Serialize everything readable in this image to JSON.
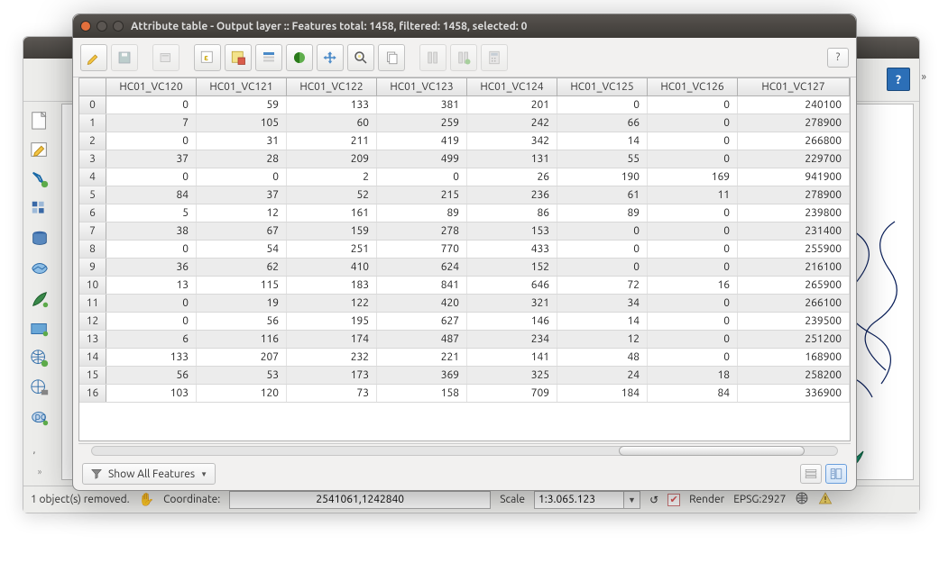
{
  "dialog": {
    "title": "Attribute table - Output layer :: Features total: 1458, filtered: 1458, selected: 0",
    "help": "?",
    "footer_filter_label": "Show All Features"
  },
  "columns": [
    "HC01_VC120",
    "HC01_VC121",
    "HC01_VC122",
    "HC01_VC123",
    "HC01_VC124",
    "HC01_VC125",
    "HC01_VC126",
    "HC01_VC127"
  ],
  "rows": [
    {
      "i": 0,
      "v": [
        0,
        59,
        133,
        381,
        201,
        0,
        0,
        240100
      ]
    },
    {
      "i": 1,
      "v": [
        7,
        105,
        60,
        259,
        242,
        66,
        0,
        278900
      ]
    },
    {
      "i": 2,
      "v": [
        0,
        31,
        211,
        419,
        342,
        14,
        0,
        266800
      ]
    },
    {
      "i": 3,
      "v": [
        37,
        28,
        209,
        499,
        131,
        55,
        0,
        229700
      ]
    },
    {
      "i": 4,
      "v": [
        0,
        0,
        2,
        0,
        26,
        190,
        169,
        941900
      ]
    },
    {
      "i": 5,
      "v": [
        84,
        37,
        52,
        215,
        236,
        61,
        11,
        278900
      ]
    },
    {
      "i": 6,
      "v": [
        5,
        12,
        161,
        89,
        86,
        89,
        0,
        239800
      ]
    },
    {
      "i": 7,
      "v": [
        38,
        67,
        159,
        278,
        153,
        0,
        0,
        231400
      ]
    },
    {
      "i": 8,
      "v": [
        0,
        54,
        251,
        770,
        433,
        0,
        0,
        255900
      ]
    },
    {
      "i": 9,
      "v": [
        36,
        62,
        410,
        624,
        152,
        0,
        0,
        216100
      ]
    },
    {
      "i": 10,
      "v": [
        13,
        115,
        183,
        841,
        646,
        72,
        16,
        265900
      ]
    },
    {
      "i": 11,
      "v": [
        0,
        19,
        122,
        420,
        321,
        34,
        0,
        266100
      ]
    },
    {
      "i": 12,
      "v": [
        0,
        56,
        195,
        627,
        146,
        14,
        0,
        239500
      ]
    },
    {
      "i": 13,
      "v": [
        6,
        116,
        174,
        487,
        234,
        12,
        0,
        251200
      ]
    },
    {
      "i": 14,
      "v": [
        133,
        207,
        232,
        221,
        141,
        48,
        0,
        168900
      ]
    },
    {
      "i": 15,
      "v": [
        56,
        53,
        173,
        369,
        325,
        24,
        18,
        258200
      ]
    },
    {
      "i": 16,
      "v": [
        103,
        120,
        73,
        158,
        709,
        184,
        84,
        336900
      ]
    }
  ],
  "status": {
    "message": "1 object(s) removed.",
    "coord_label": "Coordinate:",
    "coord_value": "2541061,1242840",
    "scale_label": "Scale",
    "scale_value": "1:3.065.123",
    "render_label": "Render",
    "epsg": "EPSG:2927"
  },
  "main_help": "?",
  "chevrons": "»"
}
